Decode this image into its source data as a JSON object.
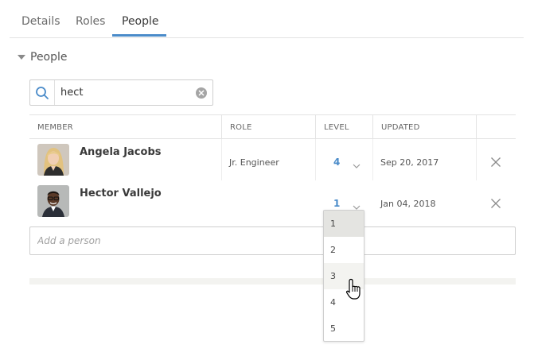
{
  "tabs": [
    {
      "label": "Details"
    },
    {
      "label": "Roles"
    },
    {
      "label": "People"
    }
  ],
  "active_tab": "People",
  "section": {
    "title": "People",
    "expanded": true
  },
  "search": {
    "value": "hect"
  },
  "table": {
    "headers": {
      "member": "MEMBER",
      "role": "ROLE",
      "level": "LEVEL",
      "updated": "UPDATED"
    },
    "rows": [
      {
        "name": "Angela Jacobs",
        "role": "Jr. Engineer",
        "level": "4",
        "updated": "Sep 20, 2017"
      },
      {
        "name": "Hector Vallejo",
        "role": "",
        "level": "1",
        "updated": "Jan 04, 2018"
      }
    ]
  },
  "add_person": {
    "placeholder": "Add a person"
  },
  "level_dropdown": {
    "open": true,
    "options": [
      "1",
      "2",
      "3",
      "4",
      "5"
    ],
    "selected": "1",
    "hovered": "3"
  },
  "colors": {
    "accent": "#4a8bc9",
    "selected_bg": "#e4e4e1",
    "hover_bg": "#f3f3f0"
  },
  "icons": {
    "search": "search-icon",
    "clear": "clear-icon",
    "remove": "close-icon",
    "chevron": "chevron-down-icon",
    "collapse": "caret-down-icon",
    "pointer": "hand-cursor-icon"
  }
}
